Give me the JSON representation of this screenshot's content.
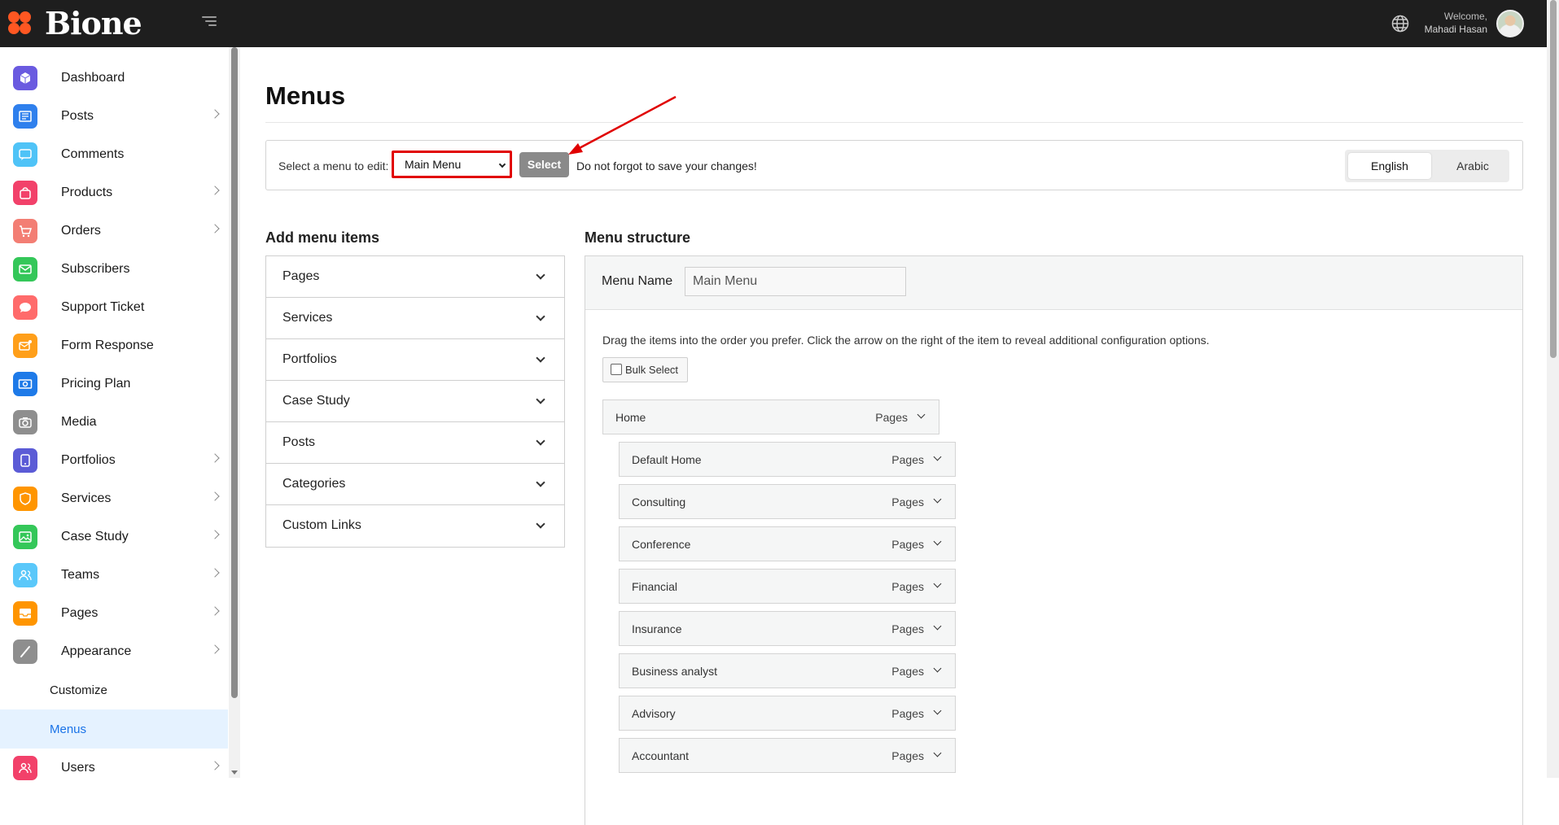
{
  "brand": {
    "name": "Bione",
    "accent": "#ff5722"
  },
  "topbar": {
    "welcome": "Welcome,",
    "user": "Mahadi Hasan"
  },
  "sidebar": {
    "items": [
      {
        "label": "Dashboard",
        "icon": "cube-icon",
        "color": "#6a5ae0",
        "chevron": false
      },
      {
        "label": "Posts",
        "icon": "newspaper-icon",
        "color": "#2f80ed",
        "chevron": true
      },
      {
        "label": "Comments",
        "icon": "comment-icon",
        "color": "#4fc3f7",
        "chevron": false
      },
      {
        "label": "Products",
        "icon": "bag-icon",
        "color": "#f2416a",
        "chevron": true
      },
      {
        "label": "Orders",
        "icon": "cart-icon",
        "color": "#f37e74",
        "chevron": true
      },
      {
        "label": "Subscribers",
        "icon": "envelope-icon",
        "color": "#34c759",
        "chevron": false
      },
      {
        "label": "Support Ticket",
        "icon": "chat-icon",
        "color": "#ff6b6b",
        "chevron": false
      },
      {
        "label": "Form Response",
        "icon": "mail-alert-icon",
        "color": "#ff9f1a",
        "chevron": false
      },
      {
        "label": "Pricing Plan",
        "icon": "money-icon",
        "color": "#1e7ae8",
        "chevron": false
      },
      {
        "label": "Media",
        "icon": "camera-icon",
        "color": "#8e8e8e",
        "chevron": false
      },
      {
        "label": "Portfolios",
        "icon": "tablet-icon",
        "color": "#5b5bd6",
        "chevron": true
      },
      {
        "label": "Services",
        "icon": "shield-icon",
        "color": "#ff9500",
        "chevron": true
      },
      {
        "label": "Case Study",
        "icon": "image-icon",
        "color": "#34c759",
        "chevron": true
      },
      {
        "label": "Teams",
        "icon": "users-icon",
        "color": "#5ac8fa",
        "chevron": true
      },
      {
        "label": "Pages",
        "icon": "inbox-icon",
        "color": "#ff9500",
        "chevron": true
      },
      {
        "label": "Appearance",
        "icon": "brush-icon",
        "color": "#8e8e8e",
        "chevron": true
      }
    ],
    "sub_items": [
      "Customize",
      "Menus"
    ],
    "last_item": {
      "label": "Users",
      "icon": "users-icon",
      "color": "#f2416a",
      "chevron": true
    }
  },
  "page": {
    "title": "Menus"
  },
  "select_bar": {
    "label": "Select a menu to edit:",
    "selected_menu": "Main Menu",
    "select_button": "Select",
    "note": "Do not forgot to save your changes!",
    "languages": [
      "English",
      "Arabic"
    ],
    "active_language": "English"
  },
  "add_items": {
    "title": "Add menu items",
    "sections": [
      "Pages",
      "Services",
      "Portfolios",
      "Case Study",
      "Posts",
      "Categories",
      "Custom Links"
    ]
  },
  "structure": {
    "title": "Menu structure",
    "menu_name_label": "Menu Name",
    "menu_name_value": "Main Menu",
    "instructions": "Drag the items into the order you prefer. Click the arrow on the right of the item to reveal additional configuration options.",
    "bulk_select": "Bulk Select",
    "items": [
      {
        "label": "Home",
        "type": "Pages",
        "depth": 0
      },
      {
        "label": "Default Home",
        "type": "Pages",
        "depth": 1
      },
      {
        "label": "Consulting",
        "type": "Pages",
        "depth": 1
      },
      {
        "label": "Conference",
        "type": "Pages",
        "depth": 1
      },
      {
        "label": "Financial",
        "type": "Pages",
        "depth": 1
      },
      {
        "label": "Insurance",
        "type": "Pages",
        "depth": 1
      },
      {
        "label": "Business analyst",
        "type": "Pages",
        "depth": 1
      },
      {
        "label": "Advisory",
        "type": "Pages",
        "depth": 1
      },
      {
        "label": "Accountant",
        "type": "Pages",
        "depth": 1
      }
    ]
  }
}
